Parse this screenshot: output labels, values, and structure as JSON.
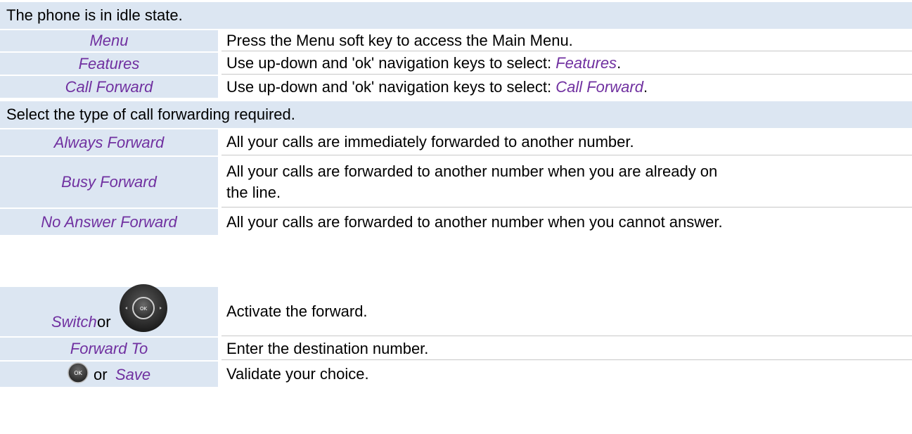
{
  "section1": {
    "header": "The phone is in idle state.",
    "rows": [
      {
        "key": "Menu",
        "desc": "Press the Menu soft key to access the Main Menu."
      },
      {
        "key": "Features",
        "desc_prefix": "Use up-down and 'ok' navigation keys to select:",
        "desc_highlight": "Features",
        "desc_suffix": "."
      },
      {
        "key": "Call Forward",
        "desc_prefix": "Use up-down and 'ok' navigation keys to select:",
        "desc_highlight": "Call Forward",
        "desc_suffix": "."
      }
    ]
  },
  "section2": {
    "header": "Select the type of call forwarding required.",
    "rows": [
      {
        "key": "Always Forward",
        "desc": "All your calls are immediately forwarded to another number."
      },
      {
        "key": "Busy Forward",
        "desc_line1": "All your calls are forwarded to another number when you are already on",
        "desc_line2": "the line."
      },
      {
        "key": "No Answer Forward",
        "desc": "All your calls are forwarded to another number when you cannot answer."
      }
    ]
  },
  "section3": {
    "rows": [
      {
        "key": "Switch",
        "connector": "or",
        "icon": "navigation-pad-ok-icon",
        "desc": "Activate the forward."
      },
      {
        "key": "Forward To",
        "desc": "Enter the destination number."
      },
      {
        "key": "Save",
        "connector": "or",
        "icon": "ok-button-icon",
        "icon_label": "OK",
        "desc": "Validate your choice."
      }
    ]
  },
  "colors": {
    "key_background": "#dce6f2",
    "key_text": "#7030a0",
    "separator": "#c8c8c8"
  }
}
